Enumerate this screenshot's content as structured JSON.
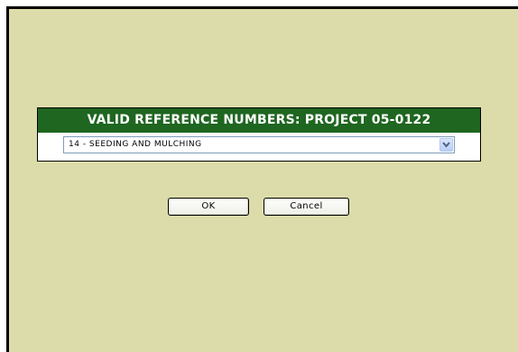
{
  "panel": {
    "title": "VALID REFERENCE NUMBERS: PROJECT 05-0122",
    "select_value": "14 - SEEDING AND MULCHING"
  },
  "buttons": {
    "ok_label": "OK",
    "cancel_label": "Cancel"
  },
  "colors": {
    "background": "#dcdcaa",
    "header": "#1f6620",
    "header_text": "#ffffff",
    "select_border": "#7f9db9",
    "arrow_button": "#c4d6fb"
  },
  "icons": {
    "dropdown": "chevron-down-icon"
  }
}
